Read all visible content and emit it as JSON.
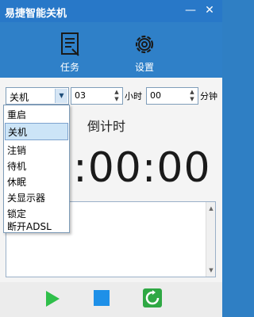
{
  "window": {
    "title": "易捷智能关机",
    "minimize_glyph": "—",
    "close_glyph": "✕"
  },
  "toolbar": {
    "task_label": "任务",
    "settings_label": "设置",
    "task_icon": "task-list-icon",
    "settings_icon": "gear-icon"
  },
  "controls": {
    "action_selected": "关机",
    "hours_value": "03",
    "hours_unit": "小时",
    "minutes_value": "00",
    "minutes_unit": "分钟"
  },
  "dropdown": {
    "items": [
      "重启",
      "关机",
      "注销",
      "待机",
      "休眠",
      "关显示器",
      "锁定",
      "断开ADSL"
    ],
    "selected_index": 1
  },
  "countdown": {
    "label": "倒计时",
    "time": "00:00:00"
  },
  "footer": {
    "play_icon": "play-icon",
    "stop_icon": "stop-icon",
    "refresh_icon": "refresh-icon"
  },
  "colors": {
    "titlebar": "#2878c8",
    "toolbar": "#2f80c8",
    "play": "#2fbf4a",
    "stop": "#1e90e8",
    "refresh": "#2fa844"
  }
}
